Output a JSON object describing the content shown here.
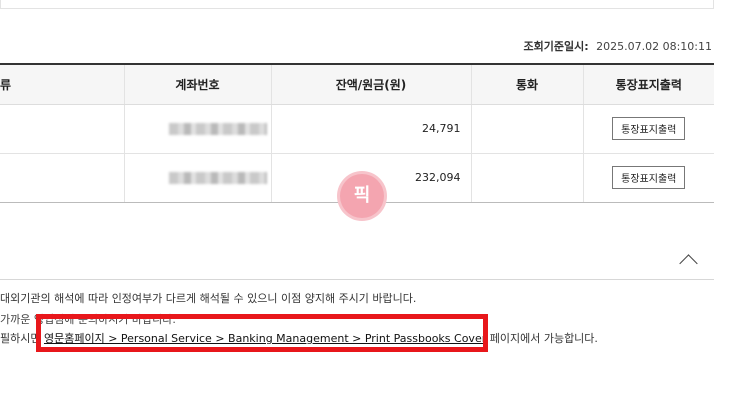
{
  "lookup": {
    "label": "조회기준일시:",
    "value": "2025.07.02 08:10:11"
  },
  "table": {
    "headers": [
      "류",
      "계좌번호",
      "잔액/원금(원)",
      "통화",
      "통장표지출력"
    ],
    "rows": [
      {
        "balance": "24,791",
        "currency": "",
        "button": "통장표지출력"
      },
      {
        "balance": "232,094",
        "currency": "",
        "button": "통장표지출력"
      }
    ]
  },
  "stamp": {
    "text": "픽"
  },
  "notices": {
    "line1": "대외기관의 해석에 따라 인정여부가 다르게 해석될 수 있으니 이점 양지해 주시기 바랍니다.",
    "line2": "가까운 영업점에 문의하시기 바랍니다.",
    "line3_prefix": "필하시면",
    "line3_link": "영문홈페이지 > Personal Service > Banking Management > Print Passbooks Cover",
    "line3_suffix": " 페이지에서 가능합니다."
  },
  "colors": {
    "highlight": "#e8171b",
    "stamp": "#f4a5b0"
  },
  "icons": {
    "collapse": "chevron-up-icon"
  }
}
